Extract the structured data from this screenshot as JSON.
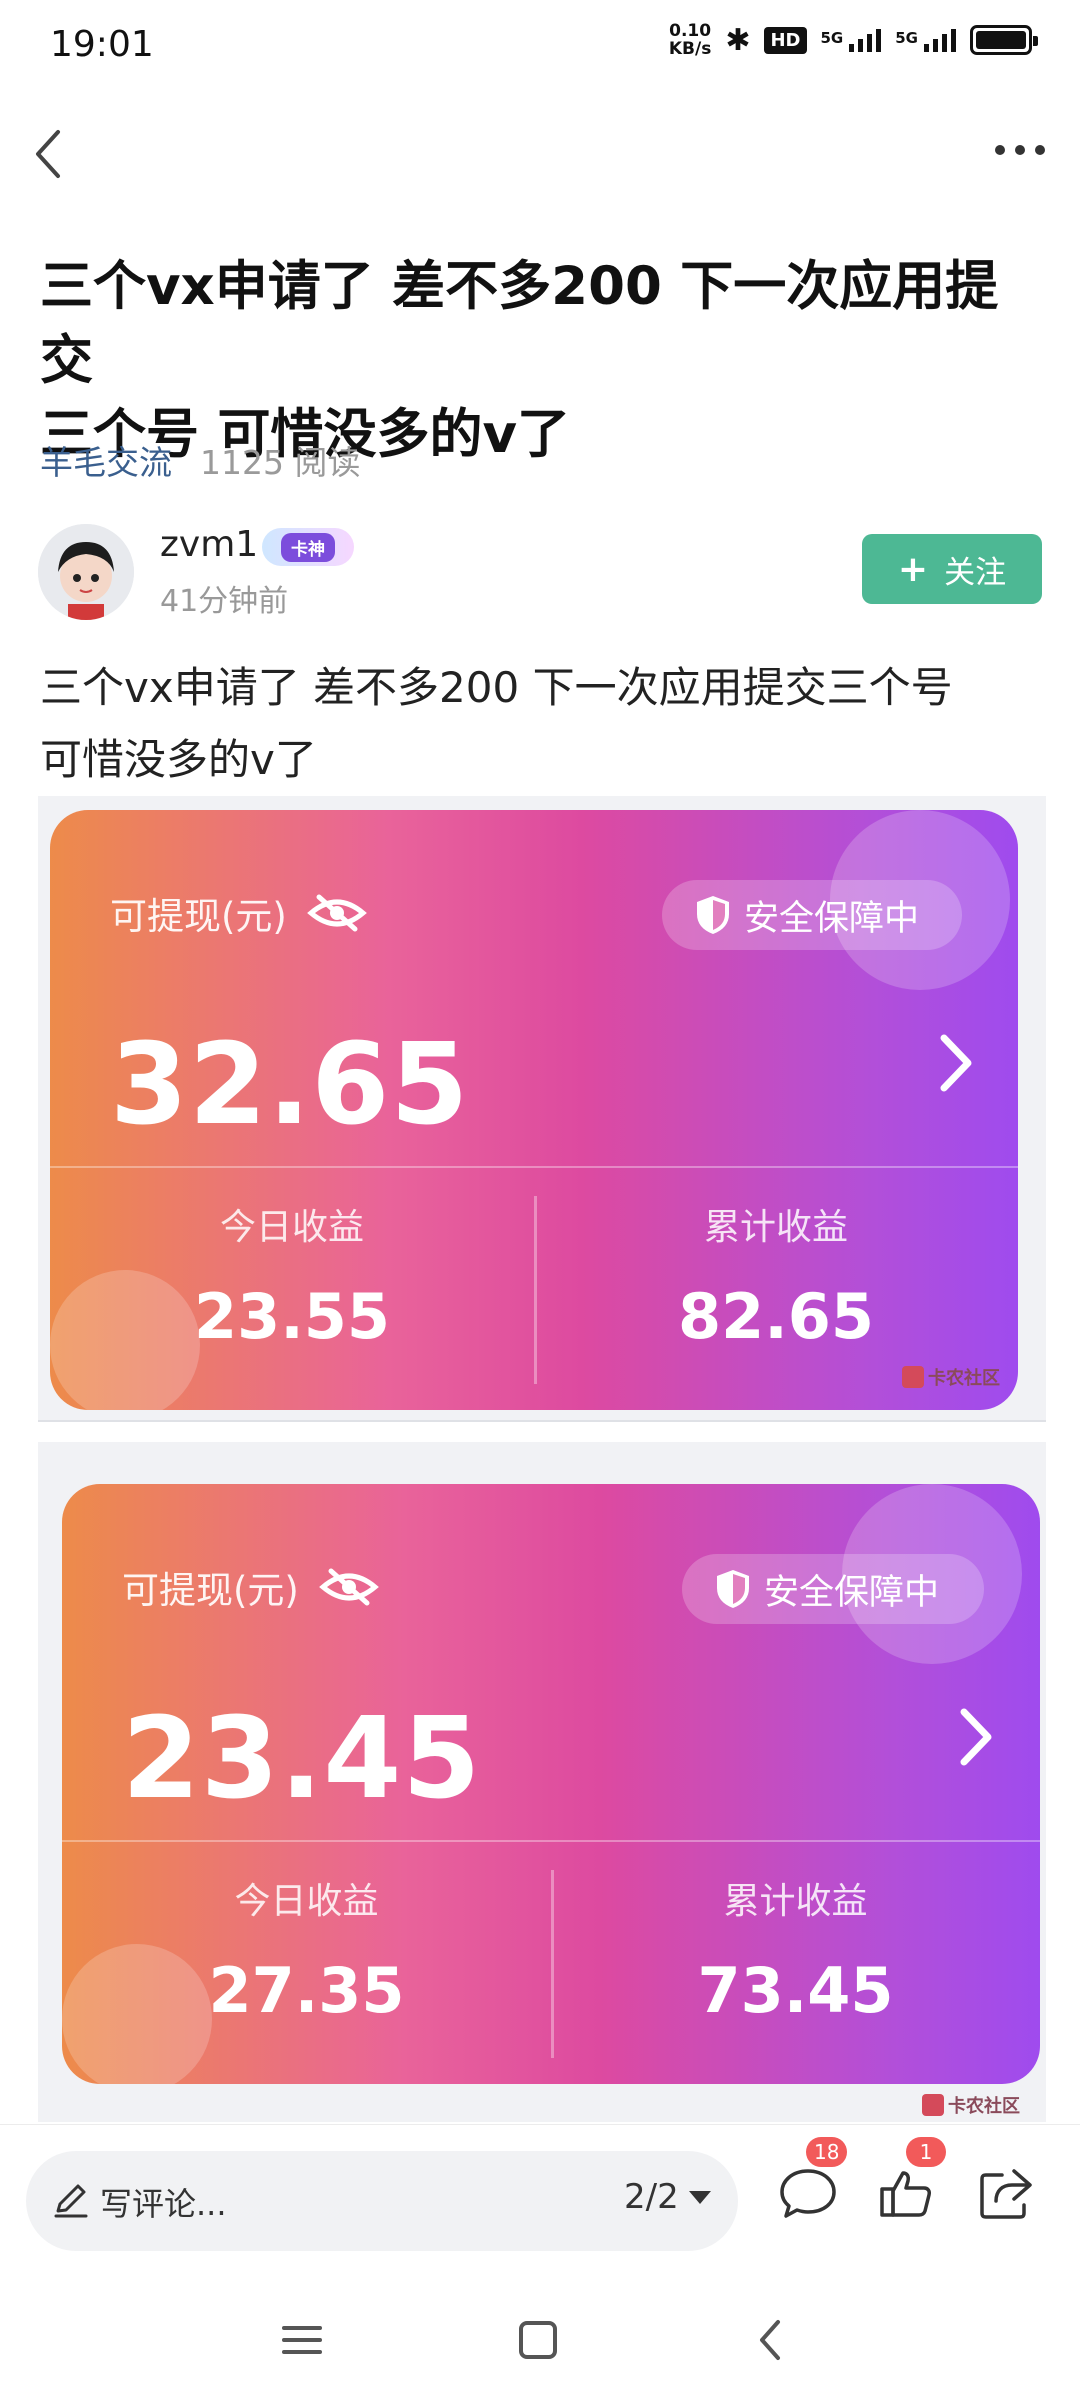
{
  "status_bar": {
    "time": "19:01",
    "net_speed_value": "0.10",
    "net_speed_unit": "KB/s",
    "hd_label": "HD",
    "signal1_label": "5G",
    "signal2_label": "5G"
  },
  "nav": {
    "back_icon": "chevron-left-icon",
    "more_icon": "more-horizontal-icon"
  },
  "post": {
    "title_line1": "三个vx申请了 差不多200 下一次应用提交",
    "title_line2": "三个号 可惜没多的v了",
    "forum": "羊毛交流",
    "reads": "1125 阅读",
    "author": {
      "name": "zvm1",
      "badge": "卡神",
      "time": "41分钟前",
      "follow_label": "关注",
      "follow_icon": "plus-icon"
    },
    "body_line1": "三个vx申请了 差不多200 下一次应用提交三个号",
    "body_line2": "可惜没多的v了"
  },
  "images": [
    {
      "withdrawable_label": "可提现(元)",
      "safety_label": "安全保障中",
      "balance": "32.65",
      "today_label": "今日收益",
      "today_value": "23.55",
      "total_label": "累计收益",
      "total_value": "82.65",
      "watermark": "卡农社区"
    },
    {
      "withdrawable_label": "可提现(元)",
      "safety_label": "安全保障中",
      "balance": "23.45",
      "today_label": "今日收益",
      "today_value": "27.35",
      "total_label": "累计收益",
      "total_value": "73.45",
      "watermark": "卡农社区"
    }
  ],
  "bottom_bar": {
    "comment_placeholder": "写评论...",
    "page_indicator": "2/2",
    "comment_count": "18",
    "like_count": "1"
  },
  "colors": {
    "follow_green": "#4db894",
    "forum_link": "#3a5f8e",
    "badge_red": "#f25a5a",
    "card_gradient_start": "#ed8b4a",
    "card_gradient_end": "#9f4bee"
  }
}
